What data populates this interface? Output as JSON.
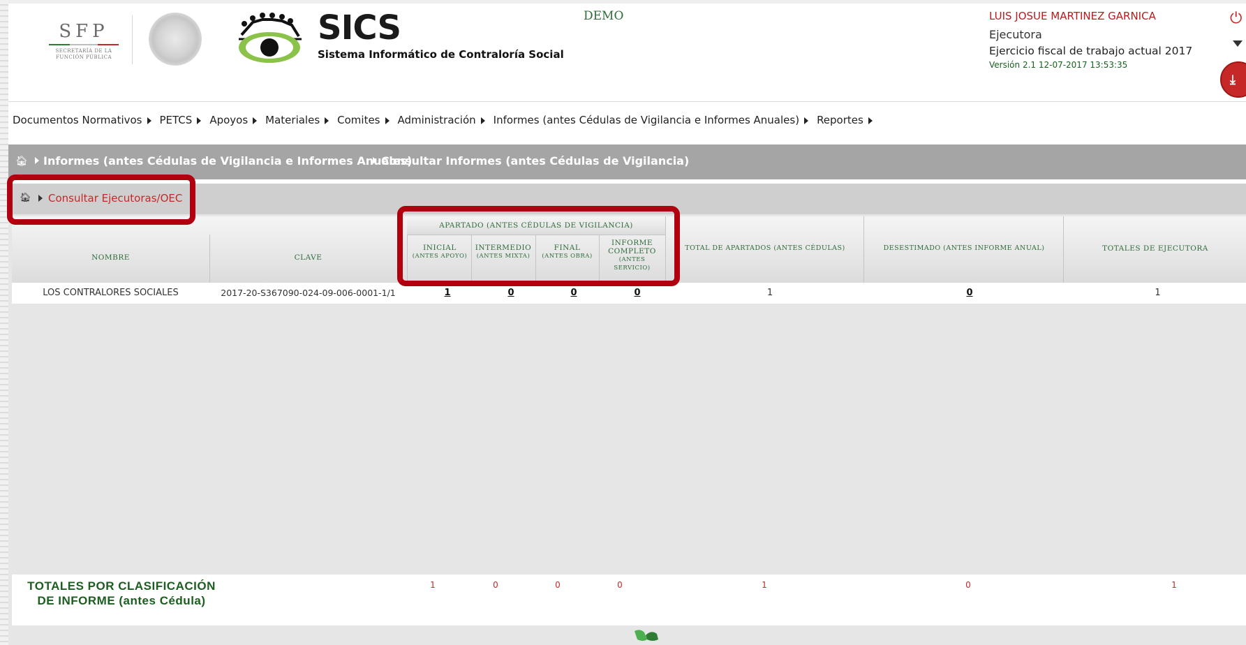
{
  "header": {
    "sfp_logo": "SFP",
    "sfp_subtitle": "SECRETARÍA DE LA FUNCIÓN PÚBLICA",
    "app_name": "SICS",
    "app_subtitle": "Sistema Informático de Contraloría Social",
    "env_label": "DEMO",
    "user_name": "LUIS JOSUE MARTINEZ GARNICA",
    "user_role": "Ejecutora",
    "fiscal_year": "Ejercicio fiscal de trabajo actual  2017",
    "version": "Versión 2.1    12-07-2017 13:53:35"
  },
  "menu": [
    {
      "label": "Documentos Normativos"
    },
    {
      "label": "PETCS"
    },
    {
      "label": "Apoyos"
    },
    {
      "label": "Materiales"
    },
    {
      "label": "Comites"
    },
    {
      "label": "Administración"
    },
    {
      "label": "Informes (antes Cédulas de Vigilancia e Informes Anuales)"
    },
    {
      "label": "Reportes"
    }
  ],
  "breadcrumb_main": {
    "items": [
      "Informes (antes Cédulas de Vigilancia e Informes Anuales)",
      "Consultar Informes (antes Cédulas de Vigilancia)"
    ]
  },
  "breadcrumb_sub": {
    "item": "Consultar Ejecutoras/OEC"
  },
  "table": {
    "group_header": "Apartado (antes Cédulas de Vigilancia)",
    "columns": {
      "nombre": "Nombre",
      "clave": "Clave",
      "inicial": "Inicial",
      "inicial_sub": "(antes Apoyo)",
      "intermedio": "Intermedio",
      "intermedio_sub": "(antes Mixta)",
      "final": "Final",
      "final_sub": "(antes Obra)",
      "informe_completo": "Informe Completo",
      "informe_completo_sub": "(antes Servicio)",
      "total_apartados": "Total de Apartados (antes Cédulas)",
      "desestimado": "Desestimado (antes Informe Anual)",
      "totales_ejecutora": "Totales de Ejecutora"
    },
    "rows": [
      {
        "nombre": "LOS CONTRALORES SOCIALES",
        "clave": "2017-20-S367090-024-09-006-0001-1/1",
        "inicial": "1",
        "intermedio": "0",
        "final": "0",
        "informe_completo": "0",
        "total_apartados": "1",
        "desestimado": "0",
        "totales_ejecutora": "1"
      }
    ],
    "totals": {
      "label": "TOTALES POR CLASIFICACIÓN DE INFORME (antes Cédula)",
      "inicial": "1",
      "intermedio": "0",
      "final": "0",
      "informe_completo": "0",
      "total_apartados": "1",
      "desestimado": "0",
      "totales_ejecutora": "1"
    }
  },
  "colors": {
    "accent_red": "#b00010",
    "header_green": "#2e6b3a",
    "user_red": "#b71c1c"
  }
}
